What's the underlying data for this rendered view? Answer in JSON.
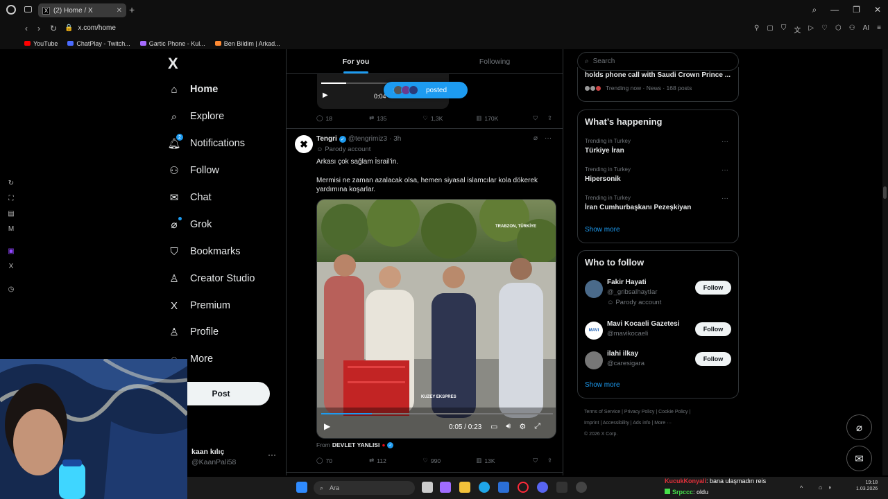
{
  "browser": {
    "tab_title": "(2) Home / X",
    "tab_favicon": "X",
    "url": "x.com/home",
    "bookmarks": [
      "YouTube",
      "ChatPlay - Twitch...",
      "Gartic Phone - Kul...",
      "Ben Bildim | Arkad..."
    ]
  },
  "nav": {
    "logo": "X",
    "items": [
      {
        "label": "Home",
        "icon": "home-icon"
      },
      {
        "label": "Explore",
        "icon": "search-icon"
      },
      {
        "label": "Notifications",
        "icon": "bell-icon",
        "badge": "2"
      },
      {
        "label": "Follow",
        "icon": "add-person-icon"
      },
      {
        "label": "Chat",
        "icon": "mail-icon"
      },
      {
        "label": "Grok",
        "icon": "grok-icon"
      },
      {
        "label": "Bookmarks",
        "icon": "bookmark-icon"
      },
      {
        "label": "Creator Studio",
        "icon": "creator-icon"
      },
      {
        "label": "Premium",
        "icon": "x-premium-icon"
      },
      {
        "label": "Profile",
        "icon": "person-icon"
      },
      {
        "label": "More",
        "icon": "more-icon"
      }
    ],
    "post_label": "Post",
    "account_name": "kaan kılıç",
    "account_handle": "@KaanPali58",
    "account_more": "···"
  },
  "feed": {
    "tabs": [
      "For you",
      "Following"
    ],
    "prev_video_time": "0:04",
    "posted_pill": "posted",
    "prev_actions": {
      "replies": "18",
      "reposts": "135",
      "likes": "1,3K",
      "views": "170K"
    },
    "tweet": {
      "name": "Tengri",
      "handle": "@tengrimiz3",
      "time": "· 3h",
      "parody": "Parody account",
      "text1": "Arkası çok sağlam İsrail'in.",
      "text2": "Mermisi ne zaman azalacak olsa, hemen siyasal islamcılar kola dökerek yardımına koşarlar.",
      "video_watermark": "TRABZON, TÜRKİYE",
      "video_caption": "KUZEY EKSPRES",
      "video_time": "0:05 / 0:23",
      "video_progress": 0.22,
      "from_label": "From",
      "from_name": "DEVLET YANLISI",
      "actions": {
        "replies": "70",
        "reposts": "112",
        "likes": "990",
        "views": "13K"
      }
    }
  },
  "right": {
    "search_placeholder": "Search",
    "prev_trend_title": "holds phone call with Saudi Crown Prince ...",
    "prev_trend_meta": "Trending now · News · 168 posts",
    "happening_title": "What’s happening",
    "trends": [
      {
        "context": "Trending in Turkey",
        "name": "Türkiye İran"
      },
      {
        "context": "Trending in Turkey",
        "name": "Hipersonik"
      },
      {
        "context": "Trending in Turkey",
        "name": "İran Cumhurbaşkanı Pezeşkiyan"
      }
    ],
    "show_more": "Show more",
    "wtf_title": "Who to follow",
    "follow_label": "Follow",
    "who_to_follow": [
      {
        "name": "Fakir Hayati",
        "handle": "@_gribsaIhaytIar",
        "note": "Parody account"
      },
      {
        "name": "Mavi Kocaeli Gazetesi",
        "handle": "@mavikocaeli",
        "note": ""
      },
      {
        "name": "ilahi ilkay",
        "handle": "@caresigara",
        "note": ""
      }
    ],
    "footer": [
      "Terms of Service",
      "Privacy Policy",
      "Cookie Policy",
      "Imprint",
      "Accessibility",
      "Ads info",
      "More ···",
      "© 2026 X Corp."
    ]
  },
  "taskbar": {
    "search_placeholder": "Ara",
    "clock_time": "19:18",
    "clock_date": "1.03.2026"
  },
  "chat_overlay": [
    {
      "user": "KucukKonyali",
      "message": ": bana ulaşmadın reis",
      "user_color": "#e0303a"
    },
    {
      "user": "Srpccc",
      "message": ": oldu",
      "user_color": "#45e04a"
    }
  ]
}
